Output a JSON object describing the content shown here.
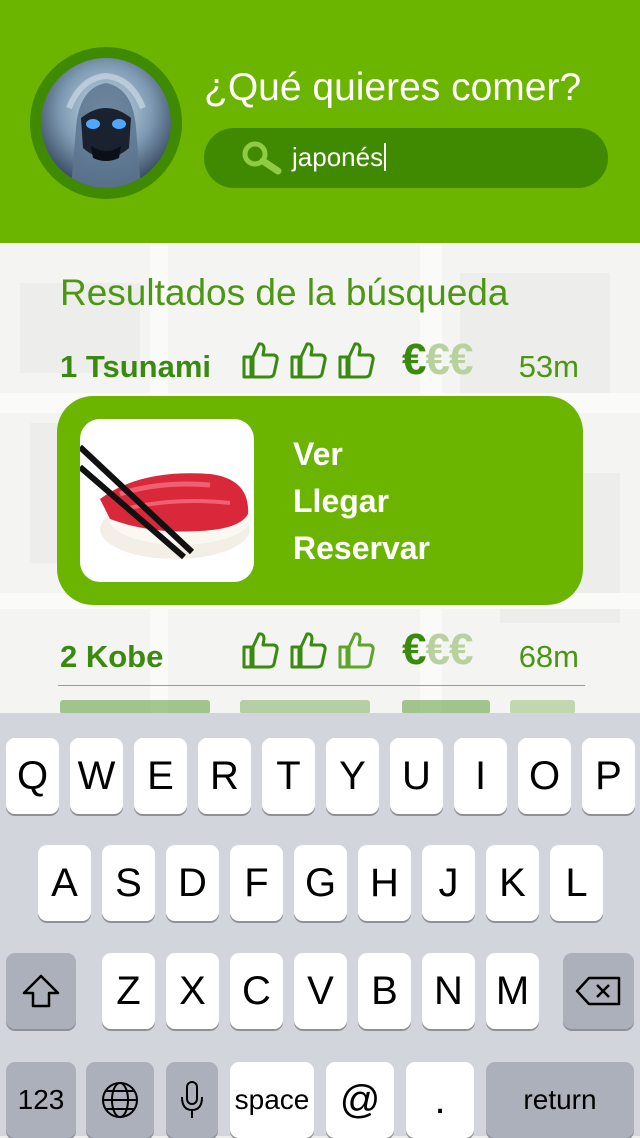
{
  "header": {
    "title": "¿Qué quieres comer?",
    "search": {
      "value": "japonés",
      "icon": "search-icon"
    },
    "avatar": "user-avatar"
  },
  "results": {
    "heading": "Resultados de la búsqueda",
    "items": [
      {
        "rank_name": "1 Tsunami",
        "thumbs_rating": 3,
        "thumbs_max": 3,
        "price_level": 1,
        "price_max": 3,
        "price_symbol": "€",
        "distance": "53m"
      },
      {
        "rank_name": "2 Kobe",
        "thumbs_rating": 2,
        "thumbs_max": 3,
        "price_level": 1,
        "price_max": 3,
        "price_symbol": "€",
        "distance": "68m"
      }
    ],
    "card": {
      "image": "sushi-photo",
      "actions": [
        "Ver",
        "Llegar",
        "Reservar"
      ]
    }
  },
  "keyboard": {
    "row1": [
      "Q",
      "W",
      "E",
      "R",
      "T",
      "Y",
      "U",
      "I",
      "O",
      "P"
    ],
    "row2": [
      "A",
      "S",
      "D",
      "F",
      "G",
      "H",
      "J",
      "K",
      "L"
    ],
    "row3": [
      "Z",
      "X",
      "C",
      "V",
      "B",
      "N",
      "M"
    ],
    "shift": "shift-icon",
    "backspace": "backspace-icon",
    "numbers": "123",
    "globe": "globe-icon",
    "mic": "microphone-icon",
    "space": "space",
    "at": "@",
    "dot": ".",
    "return": "return"
  },
  "colors": {
    "brand_green": "#6bb500",
    "dark_green": "#3f8a00",
    "text_green": "#3a8a10",
    "price_off": "#b9d19f",
    "keyboard_bg": "#d2d5db"
  }
}
